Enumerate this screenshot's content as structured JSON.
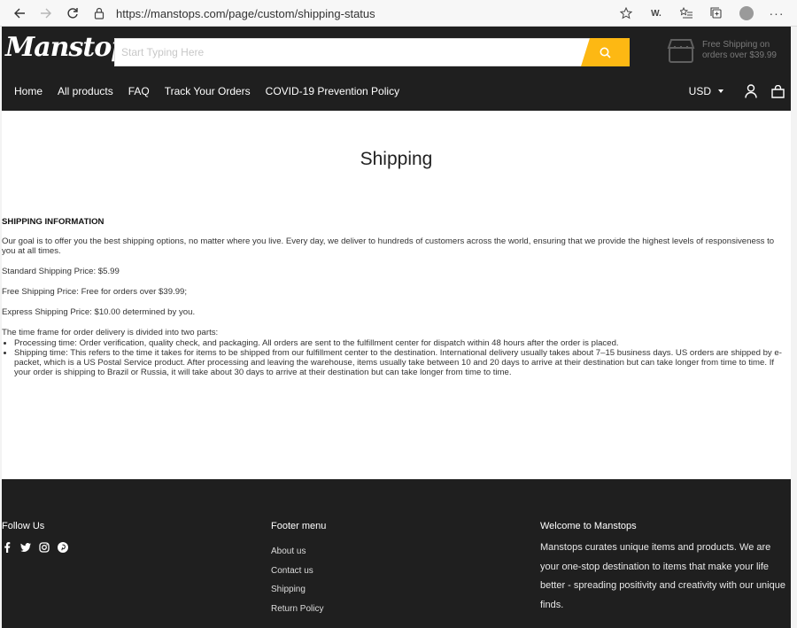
{
  "browser": {
    "url": "https://manstops.com/page/custom/shipping-status",
    "ext_label": "W."
  },
  "header": {
    "logo": "Manstops",
    "search_placeholder": "Start Typing Here",
    "promo_line1": "Free Shipping on",
    "promo_line2": "orders over $39.99",
    "menu": [
      {
        "label": "Home"
      },
      {
        "label": "All products"
      },
      {
        "label": "FAQ"
      },
      {
        "label": "Track Your Orders"
      },
      {
        "label": "COVID-19 Prevention Policy"
      }
    ],
    "currency": "USD"
  },
  "page": {
    "title": "Shipping",
    "section_heading": "SHIPPING INFORMATION",
    "intro": "Our goal is to offer you the best shipping options, no matter where you live. Every day, we deliver to hundreds of customers across the world, ensuring that we provide the highest levels of responsiveness to you at all times.",
    "standard": "Standard Shipping Price: $5.99",
    "free": "Free Shipping Price: Free for orders over $39.99;",
    "express": "Express Shipping Price: $10.00 determined by you.",
    "timeframe": "The time frame for order delivery is divided into two parts:",
    "bullets": [
      "Processing time: Order verification, quality check, and packaging. All orders are sent to the fulfillment center for dispatch within 48 hours after the order is placed.",
      "Shipping time: This refers to the time it takes for items to be shipped from our fulfillment center to the destination. International delivery usually takes about 7–15 business days. US orders are shipped by e-packet, which is a US Postal Service product. After processing and leaving the warehouse, items usually take between 10 and 20 days to arrive at their destination but can take longer from time to time. If your order is shipping to Brazil or Russia, it will take about 30 days to arrive at their destination but can take longer from time to time."
    ]
  },
  "footer": {
    "follow_title": "Follow Us",
    "menu_title": "Footer menu",
    "links": [
      "About us",
      "Contact us",
      "Shipping",
      "Return Policy"
    ],
    "welcome_title": "Welcome to Manstops",
    "welcome_text": "Manstops curates unique items and products. We are your one-stop destination to items that make your life better - spreading positivity and creativity with our unique finds."
  },
  "colors": {
    "accent": "#fdb813",
    "header_bg": "#1f1f1f"
  }
}
